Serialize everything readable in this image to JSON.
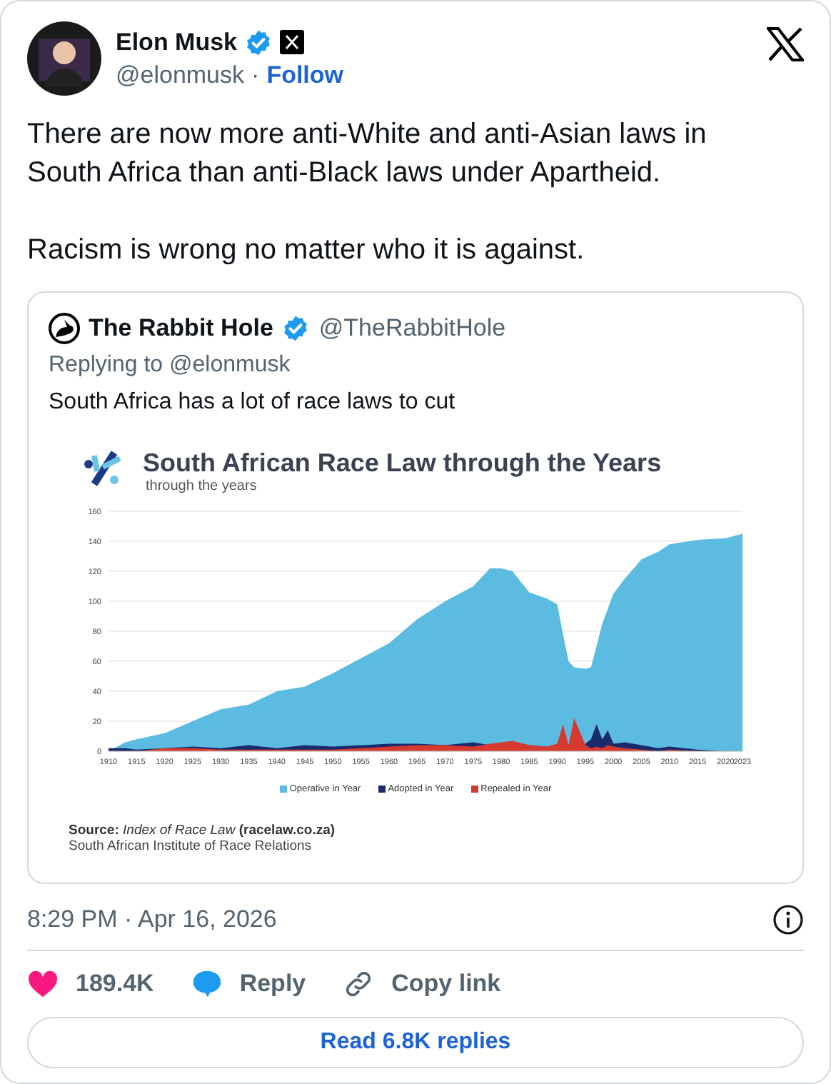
{
  "author": {
    "name": "Elon Musk",
    "verified": true,
    "handle": "@elonmusk",
    "separator": "·",
    "follow": "Follow"
  },
  "text": [
    "There are now more anti-White and anti-Asian laws in South Africa than anti-Black laws under Apartheid.",
    "Racism is wrong no matter who it is against."
  ],
  "quoted": {
    "author": {
      "name": "The Rabbit Hole",
      "verified": true,
      "handle": "@TheRabbitHole"
    },
    "replying_to": "Replying to @elonmusk",
    "text": "South Africa has a lot of race laws to cut",
    "media": {
      "subtitle": "through the years",
      "chart_data": {
        "type": "area",
        "title": "South African Race Law through the Years",
        "stacked": false,
        "x": [
          1910,
          1913,
          1915,
          1920,
          1925,
          1930,
          1935,
          1940,
          1945,
          1950,
          1955,
          1960,
          1965,
          1970,
          1975,
          1978,
          1980,
          1982,
          1985,
          1988,
          1990,
          1991,
          1992,
          1993,
          1995,
          1996,
          1997,
          1998,
          1999,
          2000,
          2002,
          2005,
          2008,
          2010,
          2015,
          2020,
          2023
        ],
        "series": [
          {
            "name": "Operative in Year",
            "color": "#5bbbe0",
            "values": [
              0,
              6,
              8,
              12,
              20,
              28,
              31,
              40,
              43,
              52,
              62,
              72,
              88,
              100,
              110,
              122,
              122,
              120,
              106,
              102,
              98,
              78,
              60,
              56,
              55,
              56,
              70,
              85,
              95,
              105,
              115,
              128,
              133,
              138,
              141,
              142,
              145
            ]
          },
          {
            "name": "Adopted in Year",
            "color": "#1a2a6c",
            "values": [
              2,
              2,
              1,
              2,
              3,
              2,
              4,
              2,
              4,
              3,
              4,
              5,
              5,
              4,
              6,
              4,
              null,
              null,
              4,
              3,
              null,
              null,
              null,
              null,
              5,
              8,
              18,
              8,
              14,
              5,
              6,
              4,
              2,
              3,
              1,
              0,
              0
            ]
          },
          {
            "name": "Repealed in Year",
            "color": "#d63a2f",
            "values": [
              0,
              0,
              0,
              2,
              2,
              1,
              1,
              1,
              1,
              1,
              2,
              3,
              4,
              4,
              3,
              5,
              6,
              7,
              4,
              3,
              5,
              18,
              4,
              22,
              4,
              2,
              3,
              2,
              4,
              3,
              2,
              1,
              0,
              1,
              0,
              0,
              0
            ]
          }
        ],
        "grid": true,
        "xlim": [
          1910,
          2023
        ],
        "ylim": [
          0,
          160
        ],
        "xticks": [
          1910,
          1915,
          1920,
          1925,
          1930,
          1935,
          1940,
          1945,
          1950,
          1955,
          1960,
          1965,
          1970,
          1975,
          1980,
          1985,
          1990,
          1995,
          2000,
          2005,
          2010,
          2015,
          2020,
          2023
        ],
        "yticks": [
          0,
          20,
          40,
          60,
          80,
          100,
          120,
          140,
          160
        ]
      },
      "source": "**Source:** *Index of Race Law* **(racelaw.co.za)**",
      "source_org": "South African Institute of Race Relations"
    }
  },
  "timestamp": "8:29 PM · Apr 16, 2026",
  "actions": [
    {
      "kind": "like",
      "label": "189.4K"
    },
    {
      "kind": "reply",
      "label": "Reply"
    },
    {
      "kind": "copy",
      "label": "Copy link"
    }
  ],
  "read_replies": "Read 6.8K replies"
}
